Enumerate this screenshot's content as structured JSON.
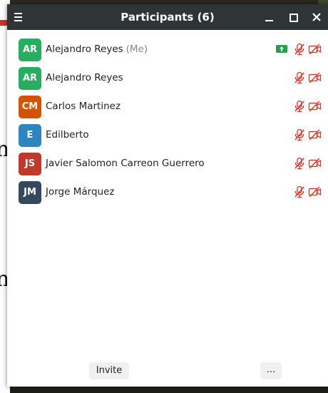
{
  "window": {
    "title": "Participants (6)"
  },
  "participants": [
    {
      "initials": "AR",
      "name": "Alejandro Reyes",
      "tag": "(Me)",
      "color": "#27ae60",
      "sharing": true
    },
    {
      "initials": "AR",
      "name": "Alejandro Reyes",
      "tag": "",
      "color": "#27ae60",
      "sharing": false
    },
    {
      "initials": "CM",
      "name": "Carlos Martinez",
      "tag": "",
      "color": "#d35400",
      "sharing": false
    },
    {
      "initials": "E",
      "name": "Edilberto",
      "tag": "",
      "color": "#2e86c1",
      "sharing": false
    },
    {
      "initials": "JS",
      "name": "Javier Salomon Carreon Guerrero",
      "tag": "",
      "color": "#c0392b",
      "sharing": false
    },
    {
      "initials": "JM",
      "name": "Jorge Márquez",
      "tag": "",
      "color": "#34495e",
      "sharing": false
    }
  ],
  "status_icons": {
    "mic": "mic-muted-icon",
    "camera": "camera-off-icon",
    "share": "screen-share-icon",
    "muted_color": "#d93025"
  },
  "footer": {
    "invite_label": "Invite",
    "more_label": "..."
  },
  "background": {
    "left_glyph": "n"
  }
}
